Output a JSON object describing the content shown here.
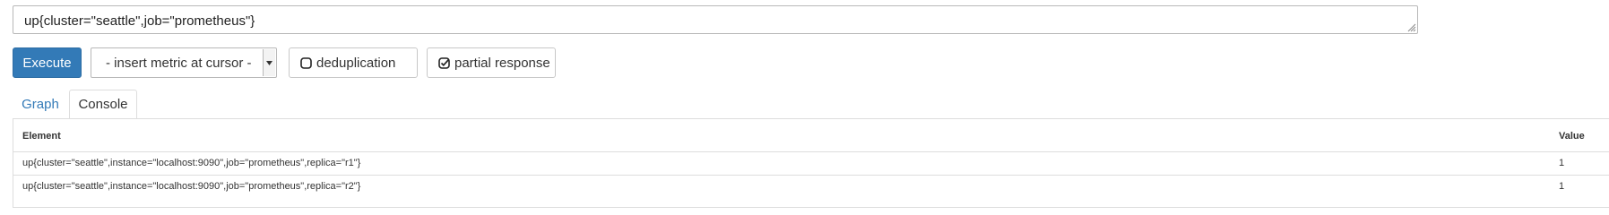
{
  "query": {
    "expression": "up{cluster=\"seattle\",job=\"prometheus\"}"
  },
  "controls": {
    "execute_label": "Execute",
    "metric_select": {
      "selected": "- insert metric at cursor -"
    },
    "deduplication": {
      "label": "deduplication",
      "checked": false,
      "icon": "checkbox-empty-icon"
    },
    "partial_response": {
      "label": "partial response",
      "checked": true,
      "icon": "checkbox-checked-icon"
    }
  },
  "tabs": [
    {
      "label": "Graph",
      "active": false
    },
    {
      "label": "Console",
      "active": true
    }
  ],
  "console": {
    "columns": [
      "Element",
      "Value"
    ],
    "rows": [
      {
        "element": "up{cluster=\"seattle\",instance=\"localhost:9090\",job=\"prometheus\",replica=\"r1\"}",
        "value": "1"
      },
      {
        "element": "up{cluster=\"seattle\",instance=\"localhost:9090\",job=\"prometheus\",replica=\"r2\"}",
        "value": "1"
      }
    ]
  },
  "colors": {
    "primary": "#337ab7",
    "border": "#dddddd",
    "text": "#333333"
  }
}
